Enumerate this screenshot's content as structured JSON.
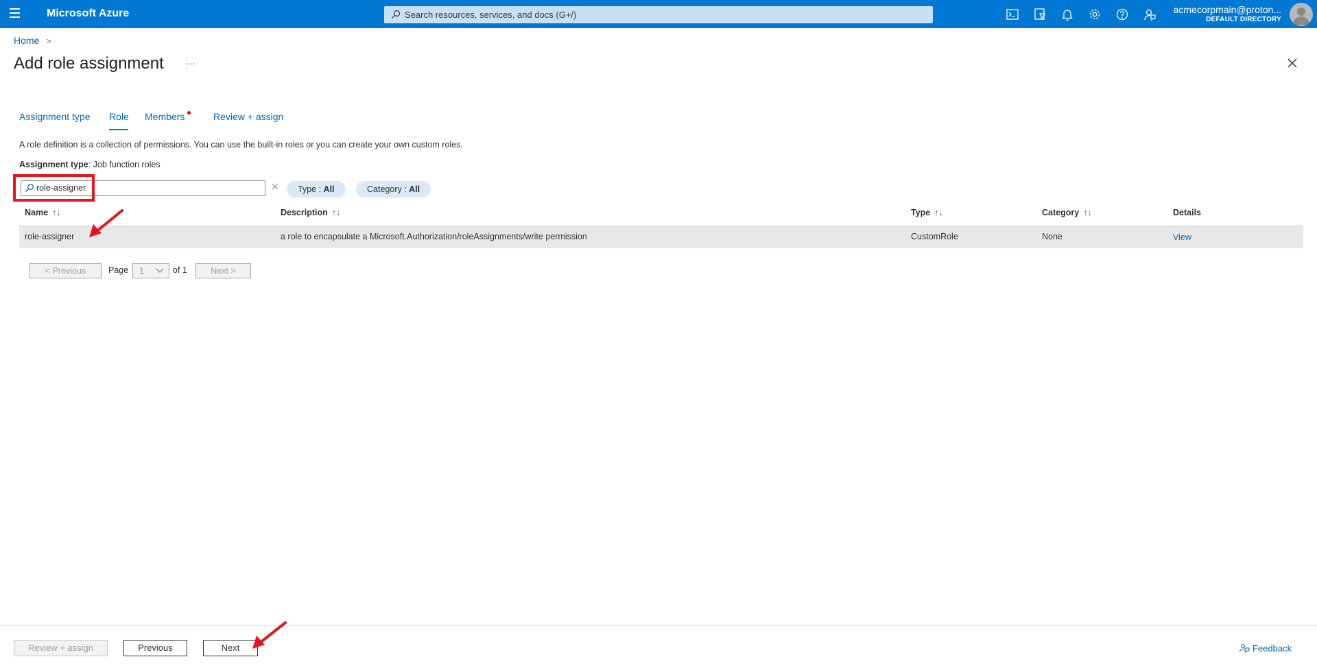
{
  "topbar": {
    "brand": "Microsoft Azure",
    "search_placeholder": "Search resources, services, and docs (G+/)",
    "icons": [
      "cloud-shell-icon",
      "directory-filter-icon",
      "notifications-icon",
      "settings-icon",
      "help-icon",
      "feedback-icon"
    ],
    "account_name": "acmecorpmain@proton...",
    "account_directory": "DEFAULT DIRECTORY"
  },
  "breadcrumb": {
    "home": "Home",
    "separator": ">"
  },
  "page": {
    "title": "Add role assignment",
    "more": "···"
  },
  "tabs": [
    {
      "label": "Assignment type"
    },
    {
      "label": "Role",
      "active": true
    },
    {
      "label": "Members"
    },
    {
      "label": "Review + assign"
    }
  ],
  "description": "A role definition is a collection of permissions. You can use the built-in roles or you can create your own custom roles.",
  "assignment_type": {
    "label": "Assignment type",
    "value": ": Job function roles"
  },
  "filter": {
    "search_value": "role-assigner",
    "type_label": "Type : ",
    "type_value": "All",
    "category_label": "Category : ",
    "category_value": "All"
  },
  "table": {
    "headers": {
      "name": "Name",
      "description": "Description",
      "type": "Type",
      "category": "Category",
      "details": "Details"
    },
    "sort_glyph": "↑↓",
    "rows": [
      {
        "name": "role-assigner",
        "description": "a role to encapsulate a Microsoft.Authorization/roleAssignments/write permission",
        "type": "CustomRole",
        "category": "None",
        "details": "View"
      }
    ]
  },
  "pager": {
    "previous": "< Previous",
    "page_label": "Page",
    "page_value": "1",
    "of_label": "of 1",
    "next": "Next >"
  },
  "footer": {
    "review_assign": "Review + assign",
    "previous": "Previous",
    "next": "Next",
    "feedback": "Feedback"
  },
  "colors": {
    "topbar": "#0078d4",
    "link": "#0067b8",
    "annotation": "#e8141c"
  }
}
